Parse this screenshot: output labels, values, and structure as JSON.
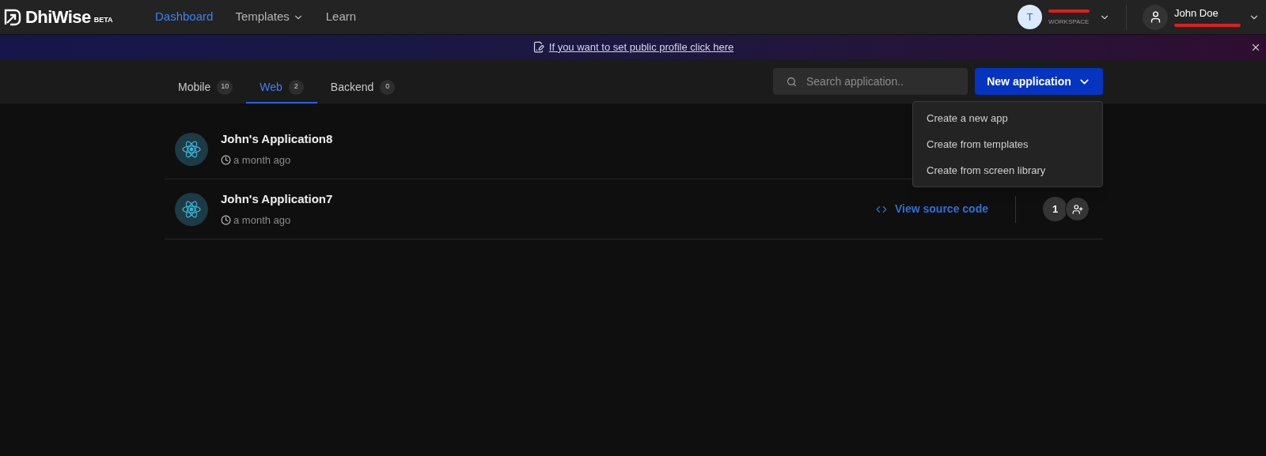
{
  "logo": {
    "name": "DhiWise",
    "badge": "BETA"
  },
  "nav": [
    {
      "label": "Dashboard",
      "selected": true,
      "has_menu": false
    },
    {
      "label": "Templates",
      "selected": false,
      "has_menu": true
    },
    {
      "label": "Learn",
      "selected": false,
      "has_menu": false
    }
  ],
  "workspace": {
    "initial": "T",
    "label": "WORKSPACE"
  },
  "user": {
    "name": "John Doe"
  },
  "banner": {
    "text": "If you want to set public profile click here"
  },
  "tabs": [
    {
      "label": "Mobile",
      "count": "10",
      "selected": false
    },
    {
      "label": "Web",
      "count": "2",
      "selected": true
    },
    {
      "label": "Backend",
      "count": "0",
      "selected": false
    }
  ],
  "search": {
    "placeholder": "Search application.."
  },
  "new_button": {
    "label": "New application"
  },
  "menu": [
    "Create a new app",
    "Create from templates",
    "Create from screen library"
  ],
  "apps": [
    {
      "name": "John's Application8",
      "time": "a month ago"
    },
    {
      "name": "John's Application7",
      "time": "a month ago",
      "action_label": "View source code",
      "members": "1"
    }
  ]
}
